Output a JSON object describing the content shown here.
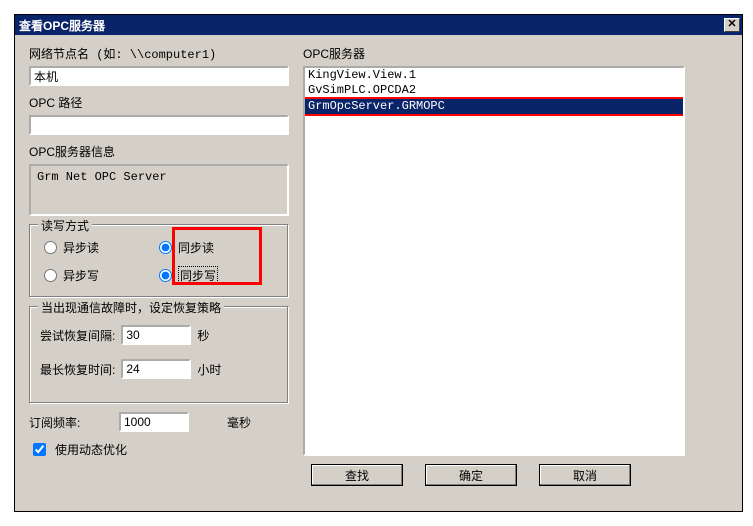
{
  "titlebar": {
    "title": "查看OPC服务器"
  },
  "left": {
    "node_label": "网络节点名 (如: \\\\computer1)",
    "node_value": "本机",
    "path_label": "OPC 路径",
    "path_value": "",
    "info_label": "OPC服务器信息",
    "info_value": "Grm Net OPC Server",
    "rw_group": "读写方式",
    "radio": {
      "async_read": "异步读",
      "sync_read": "同步读",
      "async_write": "异步写",
      "sync_write": "同步写"
    },
    "recovery_group": "当出现通信故障时，设定恢复策略",
    "retry_label": "尝试恢复间隔:",
    "retry_value": "30",
    "retry_unit": "秒",
    "maxtime_label": "最长恢复时间:",
    "maxtime_value": "24",
    "maxtime_unit": "小时",
    "freq_label": "订阅频率:",
    "freq_value": "1000",
    "freq_unit": "毫秒",
    "dynopt_label": "使用动态优化"
  },
  "right": {
    "server_label": "OPC服务器",
    "items": [
      {
        "text": "KingView.View.1",
        "selected": false
      },
      {
        "text": "GvSimPLC.OPCDA2",
        "selected": false
      },
      {
        "text": "GrmOpcServer.GRMOPC",
        "selected": true
      }
    ],
    "buttons": {
      "find": "查找",
      "ok": "确定",
      "cancel": "取消"
    }
  }
}
